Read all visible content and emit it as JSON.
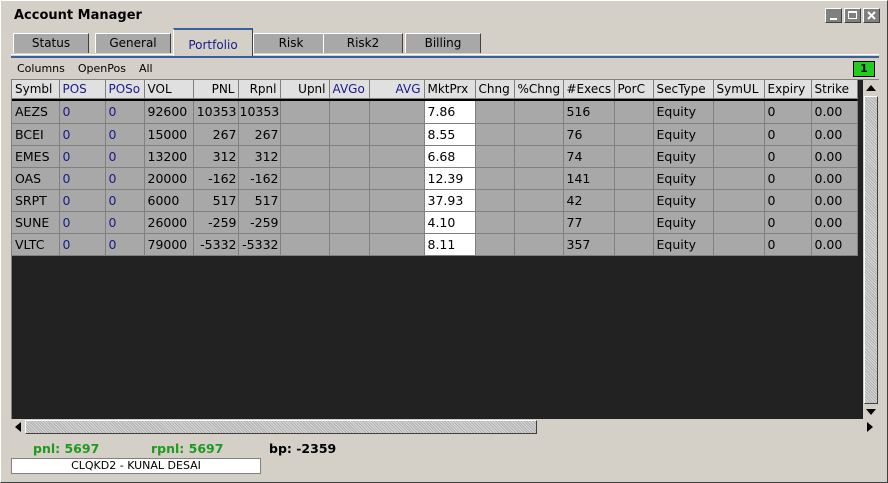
{
  "window": {
    "title": "Account Manager"
  },
  "tabs": [
    "Status",
    "General",
    "Portfolio",
    "Risk",
    "Risk2",
    "Billing"
  ],
  "active_tab": "Portfolio",
  "menu": [
    "Columns",
    "OpenPos",
    "All"
  ],
  "badge": "1",
  "columns": [
    "Symbl",
    "POS",
    "POSo",
    "VOL",
    "PNL",
    "Rpnl",
    "Upnl",
    "AVGo",
    "AVG",
    "MktPrx",
    "Chng",
    "%Chng",
    "#Execs",
    "PorC",
    "SecType",
    "SymUL",
    "Expiry",
    "Strike"
  ],
  "rows": [
    [
      "AEZS",
      "0",
      "0",
      "92600",
      "10353",
      "10353",
      "",
      "",
      "",
      "7.86",
      "",
      "",
      "516",
      "",
      "Equity",
      "",
      "0",
      "0.00"
    ],
    [
      "BCEI",
      "0",
      "0",
      "15000",
      "267",
      "267",
      "",
      "",
      "",
      "8.55",
      "",
      "",
      "76",
      "",
      "Equity",
      "",
      "0",
      "0.00"
    ],
    [
      "EMES",
      "0",
      "0",
      "13200",
      "312",
      "312",
      "",
      "",
      "",
      "6.68",
      "",
      "",
      "74",
      "",
      "Equity",
      "",
      "0",
      "0.00"
    ],
    [
      "OAS",
      "0",
      "0",
      "20000",
      "-162",
      "-162",
      "",
      "",
      "",
      "12.39",
      "",
      "",
      "141",
      "",
      "Equity",
      "",
      "0",
      "0.00"
    ],
    [
      "SRPT",
      "0",
      "0",
      "6000",
      "517",
      "517",
      "",
      "",
      "",
      "37.93",
      "",
      "",
      "42",
      "",
      "Equity",
      "",
      "0",
      "0.00"
    ],
    [
      "SUNE",
      "0",
      "0",
      "26000",
      "-259",
      "-259",
      "",
      "",
      "",
      "4.10",
      "",
      "",
      "77",
      "",
      "Equity",
      "",
      "0",
      "0.00"
    ],
    [
      "VLTC",
      "0",
      "0",
      "79000",
      "-5332",
      "-5332",
      "",
      "",
      "",
      "8.11",
      "",
      "",
      "357",
      "",
      "Equity",
      "",
      "0",
      "0.00"
    ]
  ],
  "status": {
    "pnl": "pnl: 5697",
    "rpnl": "rpnl: 5697",
    "bp": "bp: -2359",
    "user": "CLQKD2 - KUNAL DESAI"
  },
  "colors": {
    "selected_tab_border": "#3b5f9e",
    "badge": "#22cc22",
    "pnl_text": "#1f9a1f"
  }
}
